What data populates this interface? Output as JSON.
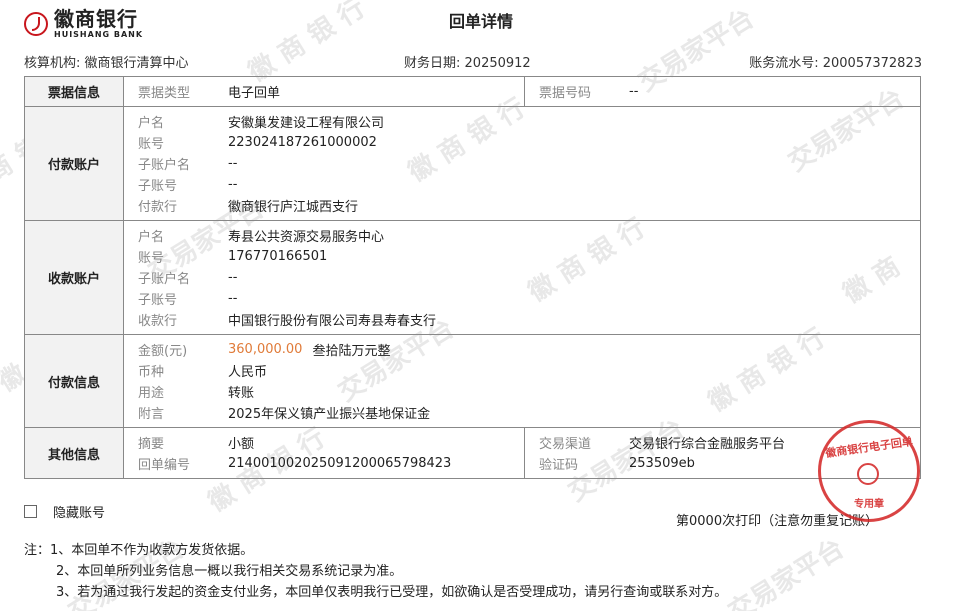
{
  "header": {
    "bank_name": "徽商银行",
    "bank_name_en": "HUISHANG BANK",
    "title": "回单详情"
  },
  "meta": {
    "org_label": "核算机构:",
    "org_value": "徽商银行清算中心",
    "date_label": "财务日期:",
    "date_value": "20250912",
    "serial_label": "账务流水号:",
    "serial_value": "200057372823"
  },
  "ticket": {
    "heading": "票据信息",
    "type_label": "票据类型",
    "type_value": "电子回单",
    "no_label": "票据号码",
    "no_value": "--"
  },
  "payer": {
    "heading": "付款账户",
    "rows": [
      {
        "label": "户名",
        "value": "安徽巢发建设工程有限公司"
      },
      {
        "label": "账号",
        "value": "223024187261000002"
      },
      {
        "label": "子账户名",
        "value": "--"
      },
      {
        "label": "子账号",
        "value": "--"
      },
      {
        "label": "付款行",
        "value": "徽商银行庐江城西支行"
      }
    ]
  },
  "payee": {
    "heading": "收款账户",
    "rows": [
      {
        "label": "户名",
        "value": "寿县公共资源交易服务中心"
      },
      {
        "label": "账号",
        "value": "176770166501"
      },
      {
        "label": "子账户名",
        "value": "--"
      },
      {
        "label": "子账号",
        "value": "--"
      },
      {
        "label": "收款行",
        "value": "中国银行股份有限公司寿县寿春支行"
      }
    ]
  },
  "payment": {
    "heading": "付款信息",
    "amount_label": "金额(元)",
    "amount_value": "360,000.00",
    "amount_cn": "叁拾陆万元整",
    "currency_label": "币种",
    "currency_value": "人民币",
    "purpose_label": "用途",
    "purpose_value": "转账",
    "remark_label": "附言",
    "remark_value": "2025年保义镇产业振兴基地保证金"
  },
  "other": {
    "heading": "其他信息",
    "summary_label": "摘要",
    "summary_value": "小额",
    "receipt_label": "回单编号",
    "receipt_value": "21400100202509120006579842 3",
    "channel_label": "交易渠道",
    "channel_value": "交易银行综合金融服务平台",
    "code_label": "验证码",
    "code_value": "253509eb"
  },
  "controls": {
    "hide_account_label": "隐藏账号",
    "hide_account_checked": false,
    "print_info": "第0000次打印（注意勿重复记账）"
  },
  "notes": {
    "prefix": "注：",
    "items": [
      "1、本回单不作为收款方发货依据。",
      "2、本回单所列业务信息一概以我行相关交易系统记录为准。",
      "3、若为通过我行发起的资金支付业务，本回单仅表明我行已受理，如欲确认是否受理成功，请另行查询或联系对方。"
    ]
  },
  "seal": {
    "top_text": "徽商银行电子回单",
    "bottom_text": "专用章",
    "color": "#d42a2a"
  },
  "colors": {
    "brand": "#c8161d",
    "amount": "#e07b39",
    "header_bg": "#f2f2f2"
  }
}
